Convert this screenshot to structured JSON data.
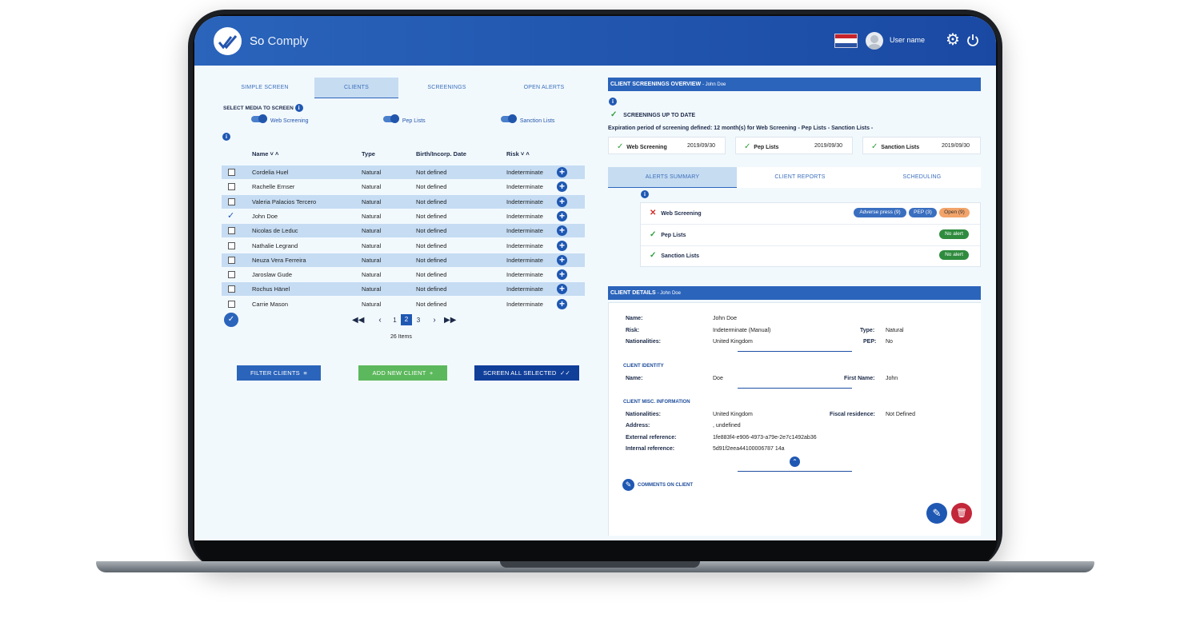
{
  "app": {
    "title_prefix": "So",
    "title_main": "Comply",
    "user_name": "User name"
  },
  "left_tabs": [
    "SIMPLE SCREEN",
    "CLIENTS",
    "SCREENINGS",
    "OPEN ALERTS"
  ],
  "media": {
    "title": "SELECT MEDIA TO SCREEN",
    "options": [
      "Web Screening",
      "Pep Lists",
      "Sanction Lists"
    ]
  },
  "table": {
    "headers": [
      "Name",
      "Type",
      "Birth/Incorp. Date",
      "Risk"
    ],
    "rows": [
      {
        "name": "Cordelia Huel",
        "type": "Natural",
        "date": "Not defined",
        "risk": "Indeterminate",
        "checked": false
      },
      {
        "name": "Rachelle Ernser",
        "type": "Natural",
        "date": "Not defined",
        "risk": "Indeterminate",
        "checked": false
      },
      {
        "name": "Valeria Palacios Tercero",
        "type": "Natural",
        "date": "Not defined",
        "risk": "Indeterminate",
        "checked": false
      },
      {
        "name": "John Doe",
        "type": "Natural",
        "date": "Not defined",
        "risk": "Indeterminate",
        "checked": true
      },
      {
        "name": "Nicolas de Leduc",
        "type": "Natural",
        "date": "Not defined",
        "risk": "Indeterminate",
        "checked": false
      },
      {
        "name": "Nathalie Legrand",
        "type": "Natural",
        "date": "Not defined",
        "risk": "Indeterminate",
        "checked": false
      },
      {
        "name": "Neuza Vera Ferreira",
        "type": "Natural",
        "date": "Not defined",
        "risk": "Indeterminate",
        "checked": false
      },
      {
        "name": "Jaroslaw Gude",
        "type": "Natural",
        "date": "Not defined",
        "risk": "Indeterminate",
        "checked": false
      },
      {
        "name": "Rochus Hänel",
        "type": "Natural",
        "date": "Not defined",
        "risk": "Indeterminate",
        "checked": false
      },
      {
        "name": "Carrie Mason",
        "type": "Natural",
        "date": "Not defined",
        "risk": "Indeterminate",
        "checked": false
      }
    ]
  },
  "pagination": {
    "pages": [
      "1",
      "2",
      "3"
    ],
    "current": "2",
    "items": "26 Items"
  },
  "buttons": {
    "filter": "FILTER CLIENTS",
    "add": "ADD NEW CLIENT",
    "screen_all": "SCREEN ALL SELECTED"
  },
  "overview": {
    "title": "CLIENT SCREENINGS OVERVIEW",
    "client": "- John Doe",
    "status": "SCREENINGS UP TO DATE",
    "expiration": "Expiration period of screening defined: 12 month(s) for Web Screening - Pep Lists - Sanction Lists -",
    "items": [
      {
        "name": "Web Screening",
        "date": "2019/09/30"
      },
      {
        "name": "Pep Lists",
        "date": "2019/09/30"
      },
      {
        "name": "Sanction Lists",
        "date": "2019/09/30"
      }
    ]
  },
  "right_tabs": [
    "ALERTS SUMMARY",
    "CLIENT REPORTS",
    "SCHEDULING"
  ],
  "alerts": {
    "web": {
      "name": "Web Screening",
      "adverse": "Adverse press (9)",
      "pep": "PEP (3)",
      "open": "Open (9)"
    },
    "pep": {
      "name": "Pep Lists",
      "badge": "No alert"
    },
    "sanction": {
      "name": "Sanction Lists",
      "badge": "No alert"
    }
  },
  "details": {
    "title": "CLIENT DETAILS",
    "client": "- John Doe",
    "name_label": "Name:",
    "name": "John Doe",
    "risk_label": "Risk:",
    "risk": "Indeterminate (Manual)",
    "type_label": "Type:",
    "type": "Natural",
    "nat_label": "Nationalities:",
    "nat": "United Kingdom",
    "pep_label": "PEP:",
    "pep": "No",
    "identity_title": "CLIENT IDENTITY",
    "id_name_label": "Name:",
    "id_name": "Doe",
    "first_label": "First Name:",
    "first": "John",
    "misc_title": "CLIENT MISC. INFORMATION",
    "misc_nat_label": "Nationalities:",
    "misc_nat": "United Kingdom",
    "fiscal_label": "Fiscal residence:",
    "fiscal": "Not Defined",
    "address_label": "Address:",
    "address": ", undefined",
    "ext_label": "External reference:",
    "ext": "1fe883f4-e906-4973-a79e-2e7c1492ab36",
    "int_label": "Internal reference:",
    "int": "5d91f2eea44100006787 14a",
    "comments": "COMMENTS ON CLIENT"
  },
  "colors": {
    "primary": "#2b64bb",
    "green": "#5cb85c",
    "navy": "#103f9a",
    "red": "#c3273a"
  }
}
